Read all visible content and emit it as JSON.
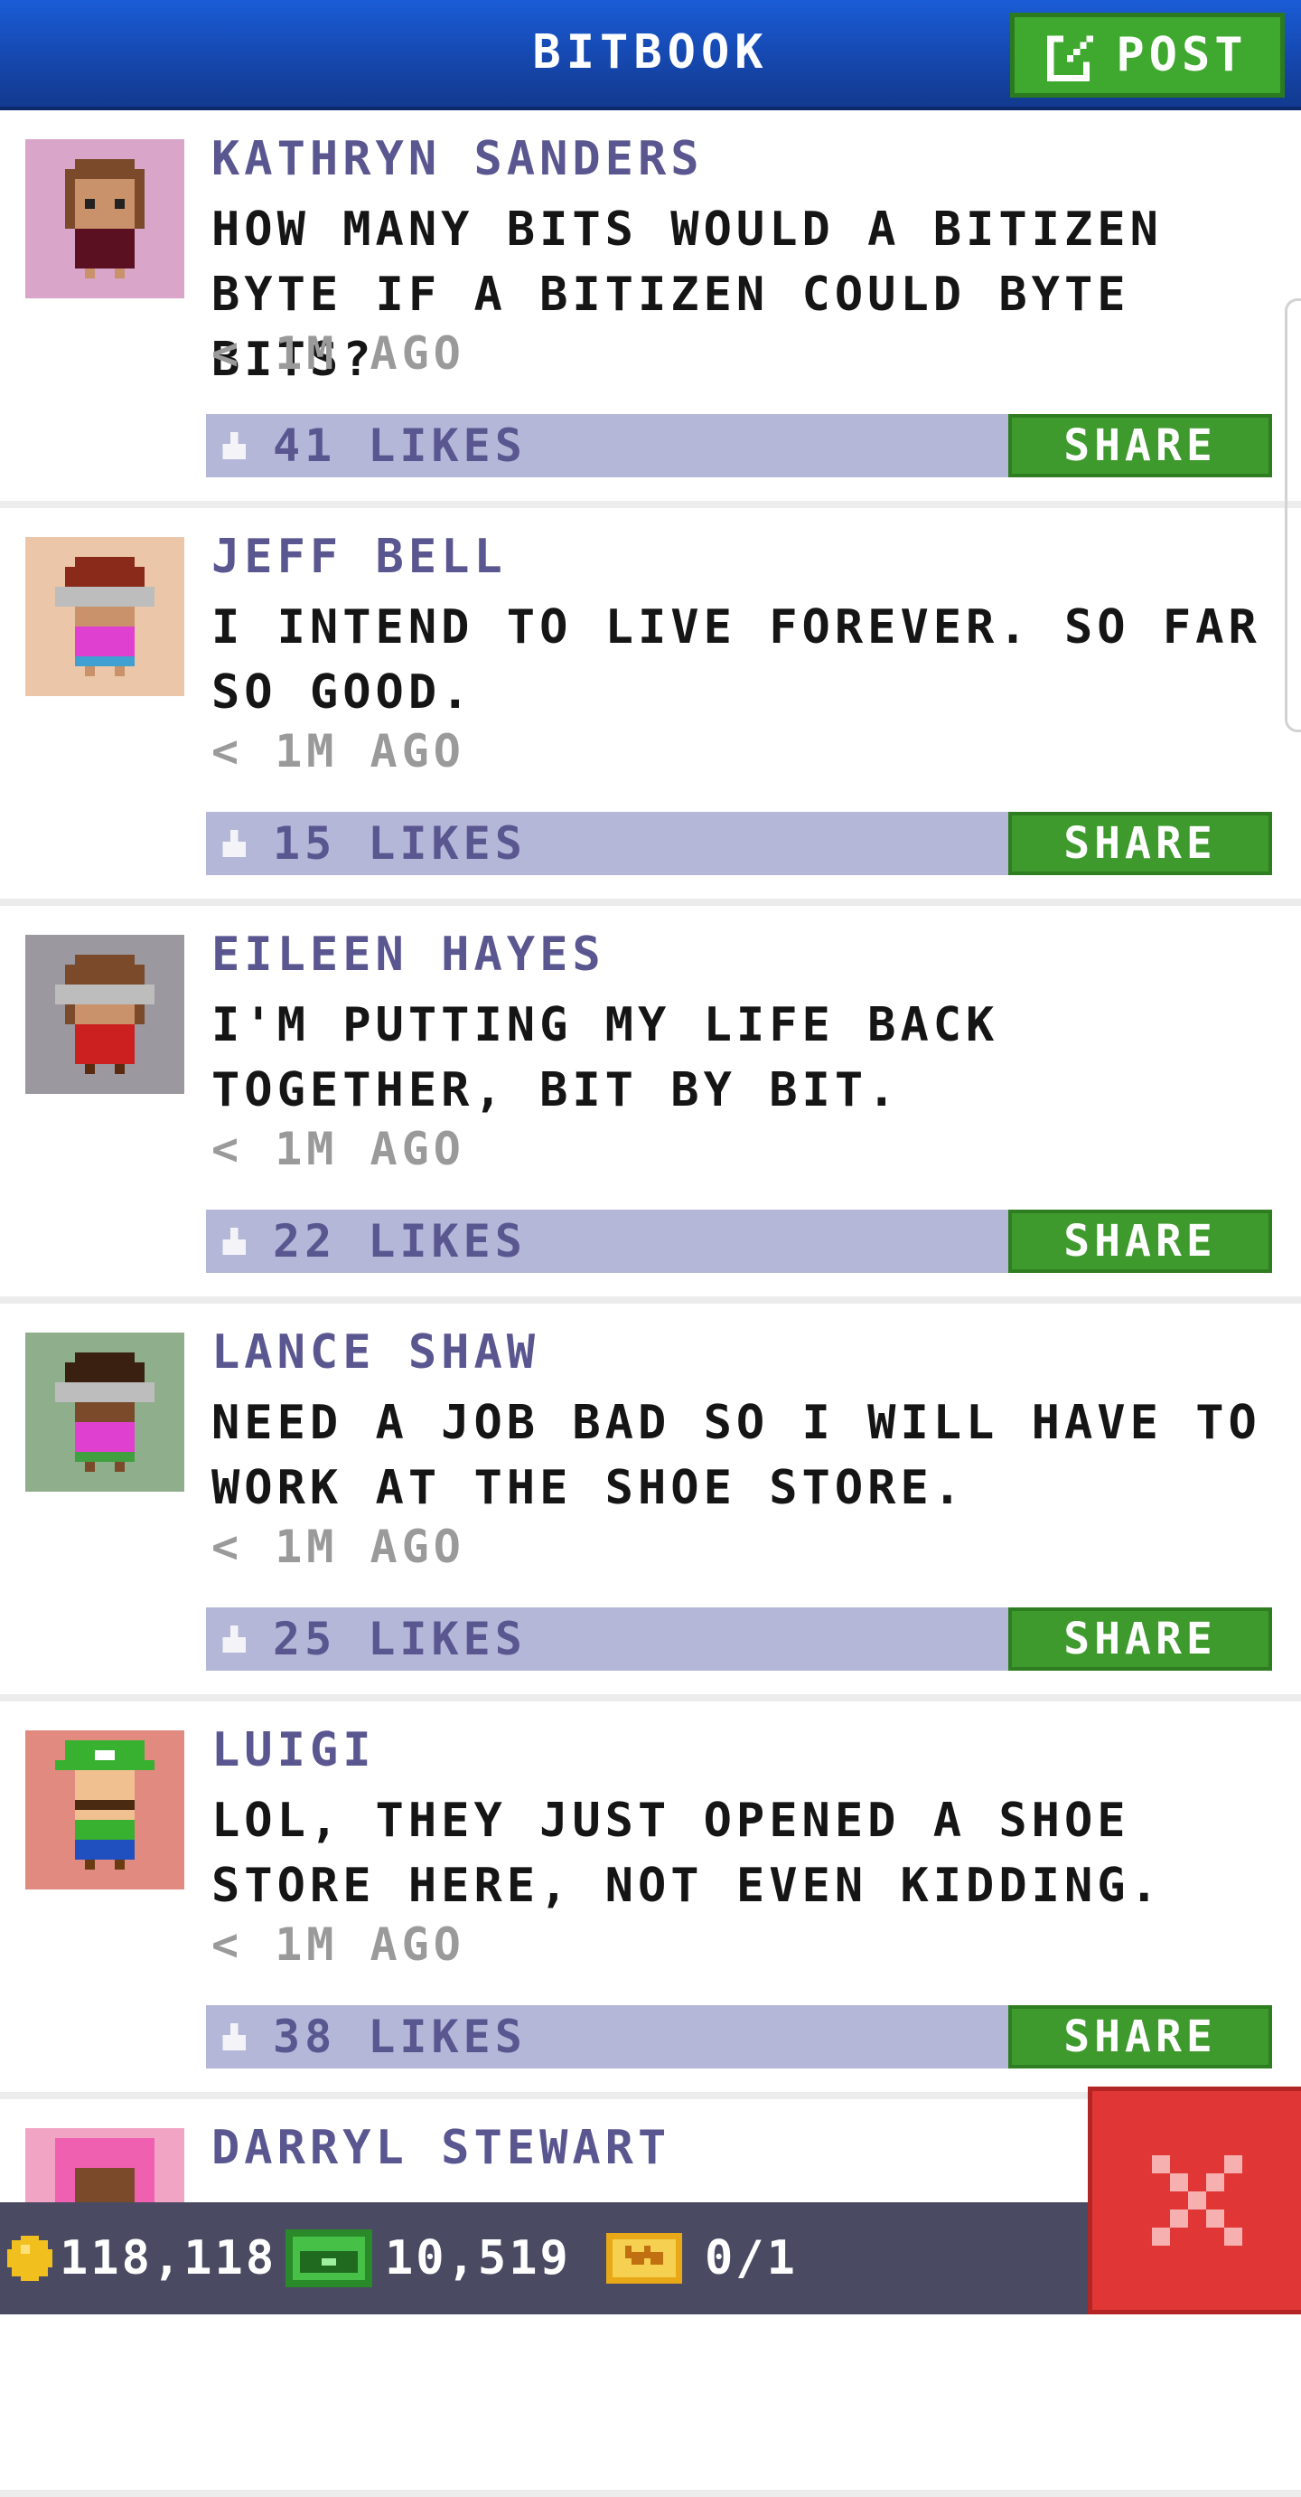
{
  "header": {
    "title": "BITBOOK",
    "post_label": "POST",
    "post_icon": "edit-icon"
  },
  "posts": [
    {
      "name": "KATHRYN SANDERS",
      "text": "HOW MANY BITS WOULD A BITIZEN BYTE IF A BITIZEN COULD BYTE BITS?",
      "time": "< 1M AGO",
      "likes": "41 LIKES",
      "share": "SHARE",
      "avatar_bg": "#d9a5c9"
    },
    {
      "name": "JEFF BELL",
      "text": "I INTEND TO LIVE FOREVER. SO FAR SO GOOD.",
      "time": "< 1M AGO",
      "likes": "15 LIKES",
      "share": "SHARE",
      "avatar_bg": "#ecc6a8"
    },
    {
      "name": "EILEEN HAYES",
      "text": "I'M PUTTING MY LIFE BACK TOGETHER, BIT BY BIT.",
      "time": "< 1M AGO",
      "likes": "22 LIKES",
      "share": "SHARE",
      "avatar_bg": "#9c98a0"
    },
    {
      "name": "LANCE SHAW",
      "text": "NEED A JOB BAD SO I WILL HAVE TO WORK AT THE SHOE STORE.",
      "time": "< 1M AGO",
      "likes": "25 LIKES",
      "share": "SHARE",
      "avatar_bg": "#8fae8c"
    },
    {
      "name": "LUIGI",
      "text": "LOL, THEY JUST OPENED A SHOE STORE HERE, NOT EVEN KIDDING.",
      "time": "< 1M AGO",
      "likes": "38 LIKES",
      "share": "SHARE",
      "avatar_bg": "#e08a80"
    },
    {
      "name": "DARRYL STEWART",
      "text": "",
      "avatar_bg": "#f2a4c4"
    }
  ],
  "bottom_bar": {
    "coins": "118,118",
    "bux": "10,519",
    "tickets": "0/1"
  },
  "icons": {
    "coin": "coin-icon",
    "bux": "bitbux-icon",
    "ticket": "vip-ticket-icon",
    "close": "close-icon",
    "like": "like-icon"
  },
  "colors": {
    "header": "#1546ab",
    "accent_green": "#3f9a2e",
    "likes_bar": "#b4b7d8",
    "name_text": "#5a5690",
    "close_red": "#e03636"
  }
}
